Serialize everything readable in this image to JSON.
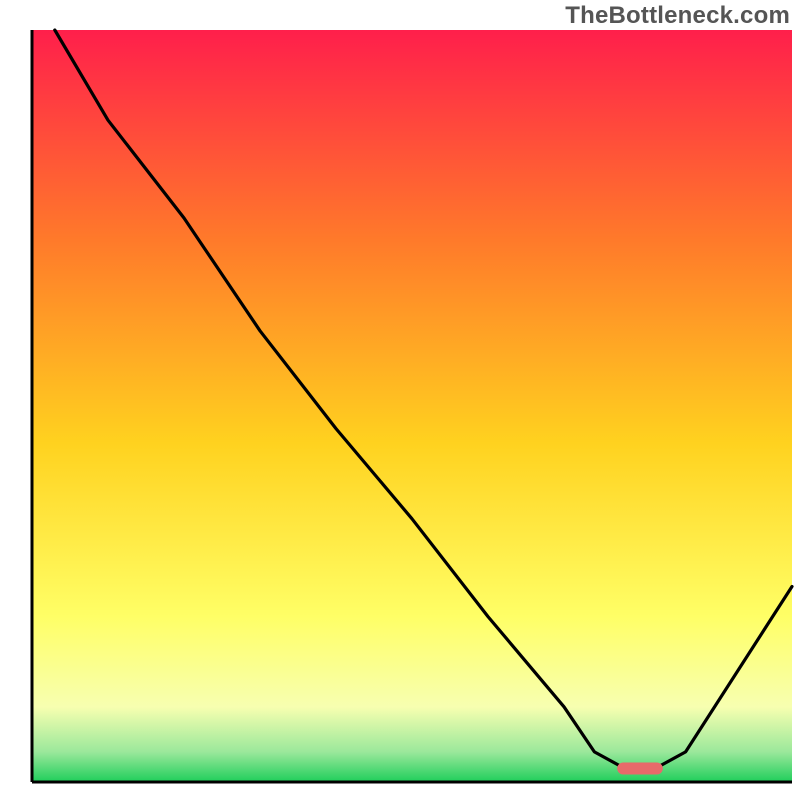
{
  "watermark": "TheBottleneck.com",
  "colors": {
    "axis": "#000000",
    "curve": "#000000",
    "marker_fill": "#e76a6a",
    "gradient_top": "#ff1f4b",
    "gradient_mid1": "#ff7a2a",
    "gradient_mid2": "#ffd21f",
    "gradient_mid3": "#ffff66",
    "gradient_mid4": "#f7ffb0",
    "gradient_band": "#9be89b",
    "gradient_bottom": "#1fce5b"
  },
  "chart_data": {
    "type": "line",
    "title": "",
    "xlabel": "",
    "ylabel": "",
    "xlim": [
      0,
      100
    ],
    "ylim": [
      0,
      100
    ],
    "grid": false,
    "legend": false,
    "series": [
      {
        "name": "bottleneck-curve",
        "x": [
          3,
          10,
          20,
          22,
          30,
          40,
          50,
          60,
          70,
          74,
          78,
          82,
          86,
          100
        ],
        "y": [
          100,
          88,
          75,
          72,
          60,
          47,
          35,
          22,
          10,
          4,
          1.8,
          1.8,
          4,
          26
        ]
      }
    ],
    "optimum_marker": {
      "x_start": 77,
      "x_end": 83,
      "y": 1.8
    }
  }
}
